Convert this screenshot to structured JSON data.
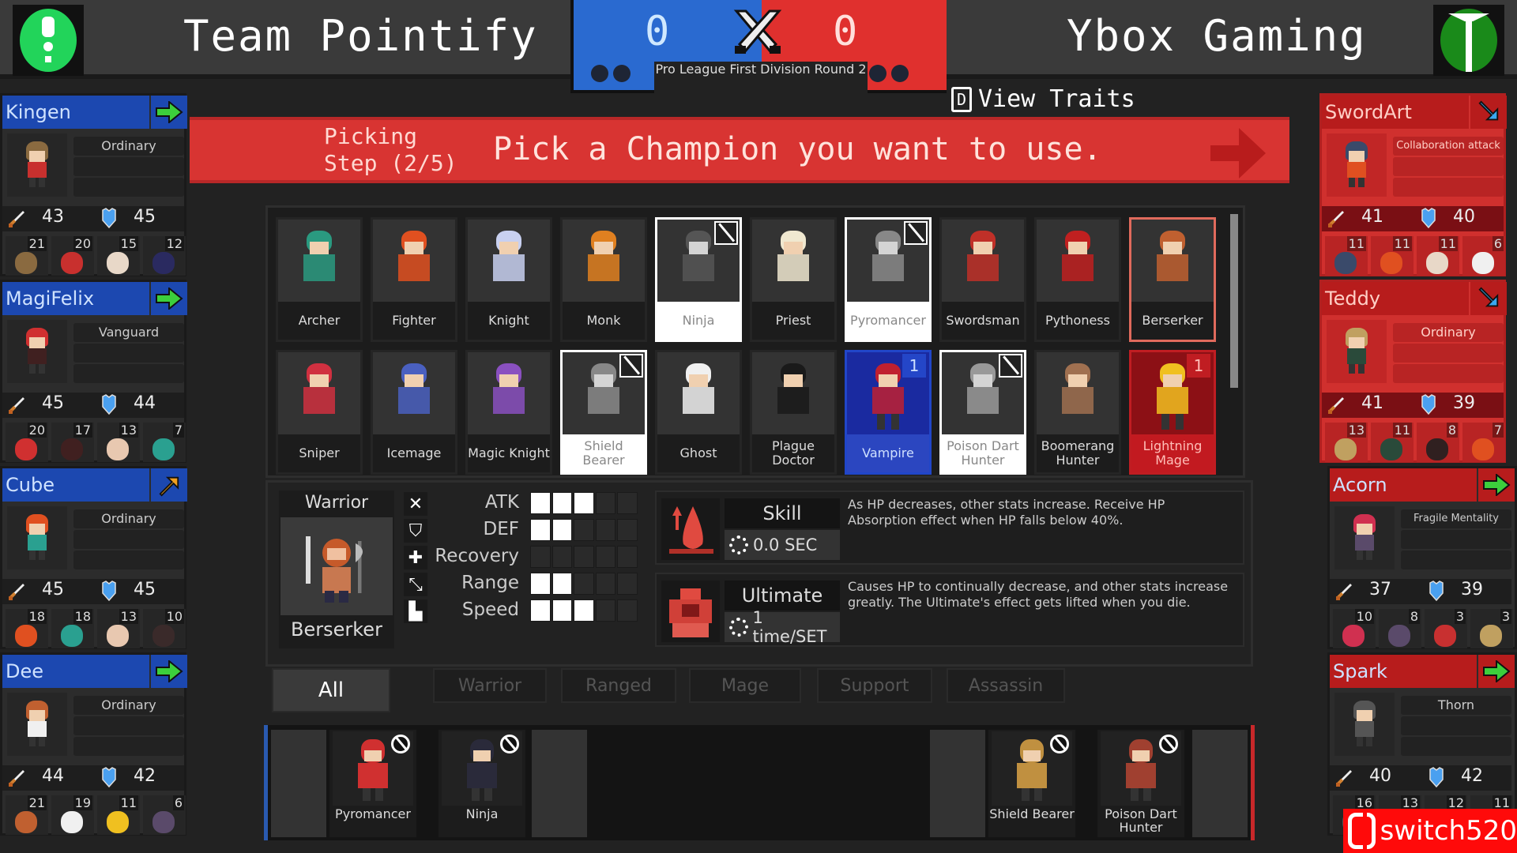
{
  "header": {
    "left_team": {
      "name": "Team Pointify",
      "score": "0",
      "logo_color": "#22d45a"
    },
    "right_team": {
      "name": "Ybox Gaming",
      "score": "0",
      "logo_color": "#1a8a1a"
    },
    "round_label": "Pro League First Division Round 2",
    "left_color": "#2a6ad0",
    "right_color": "#e0302e"
  },
  "view_traits": {
    "key": "D",
    "label": "View Traits"
  },
  "banner": {
    "step_line1": "Picking",
    "step_line2": "Step (2/5)",
    "instruction": "Pick a Champion you want to use."
  },
  "left_players": [
    {
      "name": "Kingen",
      "action": "green-arrow",
      "traits": [
        "Ordinary",
        "",
        ""
      ],
      "atk": "43",
      "def": "45",
      "champions": [
        {
          "count": "21",
          "color": "#8a6a40"
        },
        {
          "count": "20",
          "color": "#c8302e"
        },
        {
          "count": "15",
          "color": "#e8d8c8"
        },
        {
          "count": "12",
          "color": "#2a2a60"
        }
      ]
    },
    {
      "name": "MagiFelix",
      "action": "green-arrow",
      "traits": [
        "Vanguard",
        "",
        ""
      ],
      "atk": "45",
      "def": "44",
      "champions": [
        {
          "count": "20",
          "color": "#d03030"
        },
        {
          "count": "17",
          "color": "#402020"
        },
        {
          "count": "13",
          "color": "#e8c8b0"
        },
        {
          "count": "7",
          "color": "#2aa090"
        }
      ]
    },
    {
      "name": "Cube",
      "action": "orange-arrow",
      "traits": [
        "Ordinary",
        "",
        ""
      ],
      "atk": "45",
      "def": "45",
      "champions": [
        {
          "count": "18",
          "color": "#e05020"
        },
        {
          "count": "18",
          "color": "#2aa090"
        },
        {
          "count": "13",
          "color": "#e8c8b0"
        },
        {
          "count": "10",
          "color": "#3a2a2a"
        }
      ]
    },
    {
      "name": "Dee",
      "action": "green-arrow",
      "traits": [
        "Ordinary",
        "",
        ""
      ],
      "atk": "44",
      "def": "42",
      "champions": [
        {
          "count": "21",
          "color": "#c06030"
        },
        {
          "count": "19",
          "color": "#f0f0f0"
        },
        {
          "count": "11",
          "color": "#f0c020"
        },
        {
          "count": "6",
          "color": "#5a4a6a"
        }
      ]
    }
  ],
  "right_players": [
    {
      "name": "SwordArt",
      "action": "blue-arrow",
      "traits": [
        "Collaboration attack",
        "",
        ""
      ],
      "atk": "41",
      "def": "40",
      "champions": [
        {
          "count": "11",
          "color": "#3a4a6a"
        },
        {
          "count": "11",
          "color": "#e05020"
        },
        {
          "count": "11",
          "color": "#e8d8c8"
        },
        {
          "count": "6",
          "color": "#f0f0f0"
        }
      ]
    },
    {
      "name": "Teddy",
      "action": "blue-arrow",
      "traits": [
        "Ordinary",
        "",
        ""
      ],
      "atk": "41",
      "def": "39",
      "champions": [
        {
          "count": "13",
          "color": "#c0a060"
        },
        {
          "count": "11",
          "color": "#2a4a3a"
        },
        {
          "count": "8",
          "color": "#302020"
        },
        {
          "count": "7",
          "color": "#e05020"
        }
      ]
    },
    {
      "name": "Acorn",
      "action": "green-arrow",
      "traits": [
        "Fragile Mentality",
        "",
        ""
      ],
      "atk": "37",
      "def": "39",
      "champions": [
        {
          "count": "10",
          "color": "#d03050"
        },
        {
          "count": "8",
          "color": "#5a4a6a"
        },
        {
          "count": "3",
          "color": "#c83030"
        },
        {
          "count": "3",
          "color": "#c0a060"
        }
      ]
    },
    {
      "name": "Spark",
      "action": "green-arrow",
      "traits": [
        "Thorn",
        "",
        ""
      ],
      "atk": "40",
      "def": "42",
      "champions": [
        {
          "count": "16",
          "color": "#555"
        },
        {
          "count": "13",
          "color": "#555"
        },
        {
          "count": "12",
          "color": "#555"
        },
        {
          "count": "11",
          "color": "#555"
        }
      ]
    }
  ],
  "roster": [
    {
      "name": "Archer",
      "state": "normal",
      "color": "#2a9a80"
    },
    {
      "name": "Fighter",
      "state": "normal",
      "color": "#e05020"
    },
    {
      "name": "Knight",
      "state": "normal",
      "color": "#c8d0f0"
    },
    {
      "name": "Monk",
      "state": "normal",
      "color": "#e08020"
    },
    {
      "name": "Ninja",
      "state": "banned",
      "color": "#555"
    },
    {
      "name": "Priest",
      "state": "normal",
      "color": "#f0e8d0"
    },
    {
      "name": "Pyromancer",
      "state": "banned",
      "color": "#888"
    },
    {
      "name": "Swordsman",
      "state": "normal",
      "color": "#c03028"
    },
    {
      "name": "Pythoness",
      "state": "normal",
      "color": "#c02020"
    },
    {
      "name": "Berserker",
      "state": "hover",
      "color": "#c06030"
    },
    {
      "name": "Sniper",
      "state": "normal",
      "color": "#d03040"
    },
    {
      "name": "Icemage",
      "state": "normal",
      "color": "#4a60c0"
    },
    {
      "name": "Magic Knight",
      "state": "normal",
      "color": "#8a50c0"
    },
    {
      "name": "Shield Bearer",
      "state": "banned",
      "color": "#888"
    },
    {
      "name": "Ghost",
      "state": "normal",
      "color": "#f0f0f0"
    },
    {
      "name": "Plague Doctor",
      "state": "normal",
      "color": "#1a1a1a"
    },
    {
      "name": "Vampire",
      "state": "picked-blue",
      "pick": "1",
      "color": "#c02030"
    },
    {
      "name": "Poison Dart Hunter",
      "state": "banned",
      "color": "#999"
    },
    {
      "name": "Boomerang Hunter",
      "state": "normal",
      "color": "#a07050"
    },
    {
      "name": "Lightning Mage",
      "state": "picked-red",
      "pick": "1",
      "color": "#f0c020"
    }
  ],
  "detail": {
    "class": "Warrior",
    "champion": "Berserker",
    "stats": [
      {
        "label": "ATK",
        "icon": "sword-icon",
        "value": 3,
        "max": 5
      },
      {
        "label": "DEF",
        "icon": "shield-icon",
        "value": 2,
        "max": 5
      },
      {
        "label": "Recovery",
        "icon": "plus-icon",
        "value": 0,
        "max": 5
      },
      {
        "label": "Range",
        "icon": "range-icon",
        "value": 2,
        "max": 5
      },
      {
        "label": "Speed",
        "icon": "boot-icon",
        "value": 3,
        "max": 5
      }
    ],
    "skill": {
      "label": "Skill",
      "cooldown": "0.0 SEC",
      "description": "As HP decreases, other stats increase. Receive HP Absorption effect when HP falls below 40%."
    },
    "ultimate": {
      "label": "Ultimate",
      "cooldown": "1 time/SET",
      "description": "Causes HP to continually decrease, and other stats increase greatly. The Ultimate's effect gets lifted when you die."
    }
  },
  "filters": [
    "All",
    "Warrior",
    "Ranged",
    "Mage",
    "Support",
    "Assassin"
  ],
  "active_filter": "All",
  "bans": {
    "left": [
      {
        "name": "Pyromancer",
        "color": "#d03030"
      },
      {
        "name": "Ninja",
        "color": "#2a2a3a"
      }
    ],
    "right": [
      {
        "name": "Shield Bearer",
        "color": "#c09040"
      },
      {
        "name": "Poison Dart Hunter",
        "color": "#a04030"
      }
    ]
  },
  "watermark": "switch520"
}
